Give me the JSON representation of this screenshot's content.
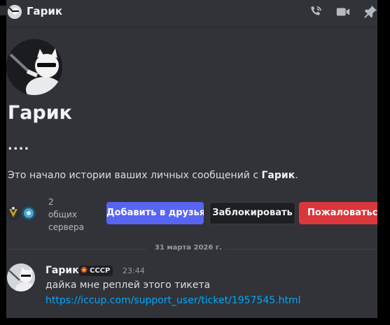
{
  "header": {
    "name": "Гарик",
    "icons": [
      "phone-icon",
      "video-icon",
      "pin-icon"
    ]
  },
  "profile": {
    "name": "Гарик",
    "dots": "....",
    "intro_prefix": "Это начало истории ваших личных сообщений с ",
    "intro_name": "Гарик",
    "intro_suffix": "."
  },
  "mutual": {
    "line1": "2",
    "line2": "общих",
    "line3": "сервера"
  },
  "buttons": {
    "add_friend": "Добавить в друзья",
    "block": "Заблокировать",
    "report": "Пожаловаться на"
  },
  "divider": {
    "date": "31 марта 2026 г."
  },
  "message": {
    "author": "Гарик",
    "tag": "CCCP",
    "time": "23:44",
    "text": "дайка мне реплей этого тикета",
    "link": "https://iccup.com/support_user/ticket/1957545.html"
  },
  "colors": {
    "background": "#313338",
    "blurple": "#5865f2",
    "danger": "#da373c",
    "link": "#00a8fc"
  }
}
